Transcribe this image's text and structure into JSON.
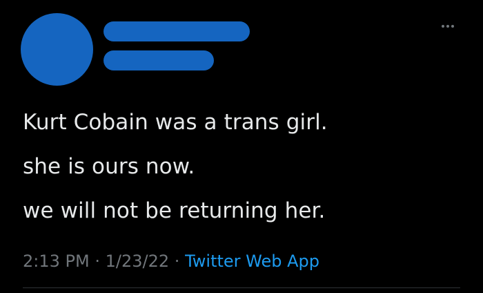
{
  "tweet": {
    "lines": [
      "Kurt Cobain was a trans girl.",
      "she is ours now.",
      "we will not be returning her."
    ],
    "time": "2:13 PM",
    "separator": "·",
    "date": "1/23/22",
    "source": "Twitter Web App"
  },
  "colors": {
    "redaction": "#1565c0",
    "link": "#1d9bf0",
    "muted": "#71767b",
    "text": "#e7e9ea",
    "background": "#000000"
  },
  "icons": {
    "more": "more-horizontal-icon"
  }
}
